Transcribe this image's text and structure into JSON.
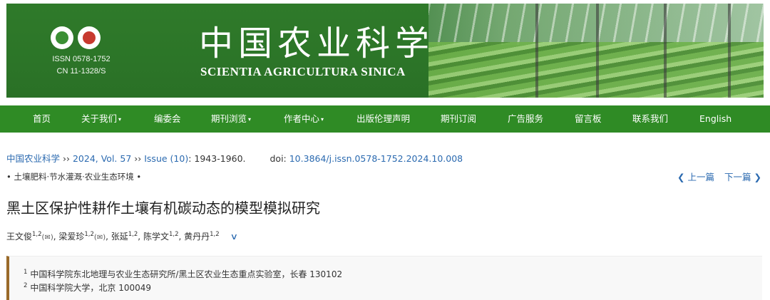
{
  "header": {
    "issn": "ISSN 0578-1752",
    "cn": "CN 11-1328/S",
    "title_cn": "中国农业科学",
    "title_en": "SCIENTIA AGRICULTURA SINICA"
  },
  "nav": {
    "items": [
      {
        "label": "首页",
        "dropdown": false
      },
      {
        "label": "关于我们",
        "dropdown": true
      },
      {
        "label": "编委会",
        "dropdown": false
      },
      {
        "label": "期刊浏览",
        "dropdown": true
      },
      {
        "label": "作者中心",
        "dropdown": true
      },
      {
        "label": "出版伦理声明",
        "dropdown": false
      },
      {
        "label": "期刊订阅",
        "dropdown": false
      },
      {
        "label": "广告服务",
        "dropdown": false
      },
      {
        "label": "留言板",
        "dropdown": false
      },
      {
        "label": "联系我们",
        "dropdown": false
      },
      {
        "label": "English",
        "dropdown": false
      }
    ],
    "caret": "▾"
  },
  "breadcrumb": {
    "journal": "中国农业科学",
    "sep": " ›› ",
    "volume": "2024, Vol. 57",
    "issue": "Issue (10)",
    "pages": ": 1943-1960.",
    "doi_label": "doi: ",
    "doi": "10.3864/j.issn.0578-1752.2024.10.008"
  },
  "category": "• 土壤肥料·节水灌溉·农业生态环境 •",
  "pager": {
    "prev": "上一篇",
    "next": "下一篇",
    "prev_icon": "❮",
    "next_icon": "❯"
  },
  "article": {
    "title": "黑土区保护性耕作土壤有机碳动态的模型模拟研究",
    "authors": [
      {
        "name": "王文俊",
        "aff": "1,2",
        "mail": "(✉)",
        "sep": ", "
      },
      {
        "name": "梁爱珍",
        "aff": "1,2",
        "mail": "(✉)",
        "sep": ", "
      },
      {
        "name": "张延",
        "aff": "1,2",
        "mail": "",
        "sep": ", "
      },
      {
        "name": "陈学文",
        "aff": "1,2",
        "mail": "",
        "sep": ", "
      },
      {
        "name": "黄丹丹",
        "aff": "1,2",
        "mail": "",
        "sep": ""
      }
    ],
    "expand_icon": "∨"
  },
  "affiliations": [
    {
      "num": "1",
      "text": "中国科学院东北地理与农业生态研究所/黑土区农业生态重点实验室，长春 130102"
    },
    {
      "num": "2",
      "text": "中国科学院大学，北京 100049"
    }
  ]
}
